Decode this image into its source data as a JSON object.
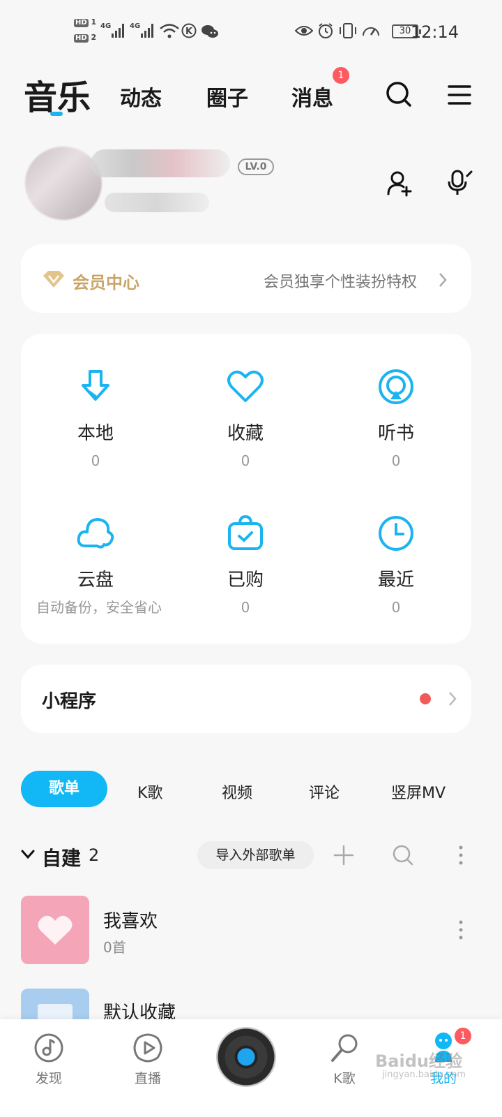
{
  "status_bar": {
    "hd1": "HD",
    "hd2": "HD",
    "net1": "4G",
    "net2": "4G",
    "battery": "30",
    "time": "12:14"
  },
  "top_nav": {
    "tabs": [
      "音乐",
      "动态",
      "圈子",
      "消息"
    ],
    "message_badge": "1"
  },
  "profile": {
    "level": "LV.0"
  },
  "vip": {
    "title": "会员中心",
    "desc": "会员独享个性装扮特权"
  },
  "grid": [
    {
      "label": "本地",
      "count": "0",
      "icon": "download-icon"
    },
    {
      "label": "收藏",
      "count": "0",
      "icon": "heart-icon"
    },
    {
      "label": "听书",
      "count": "0",
      "icon": "podcast-icon"
    },
    {
      "label": "云盘",
      "count": "自动备份，安全省心",
      "icon": "cloud-icon"
    },
    {
      "label": "已购",
      "count": "0",
      "icon": "purchased-bag-icon"
    },
    {
      "label": "最近",
      "count": "0",
      "icon": "clock-icon"
    }
  ],
  "mini_program": {
    "title": "小程序"
  },
  "categories": [
    "歌单",
    "K歌",
    "视频",
    "评论",
    "竖屏MV"
  ],
  "playlists_section": {
    "title": "自建",
    "count": "2",
    "import_label": "导入外部歌单"
  },
  "playlists": [
    {
      "name": "我喜欢",
      "sub": "0首"
    },
    {
      "name": "默认收藏",
      "sub": ""
    }
  ],
  "bottom_nav": {
    "items": [
      "发现",
      "直播",
      "K歌",
      "我的"
    ],
    "badge": "1"
  },
  "watermark": {
    "text": "Baidu经验",
    "sub": "jingyan.baidu.com"
  },
  "colors": {
    "accent": "#12b7f5",
    "badge": "#ff5a5f",
    "vip_gold": "#c9a56a"
  }
}
